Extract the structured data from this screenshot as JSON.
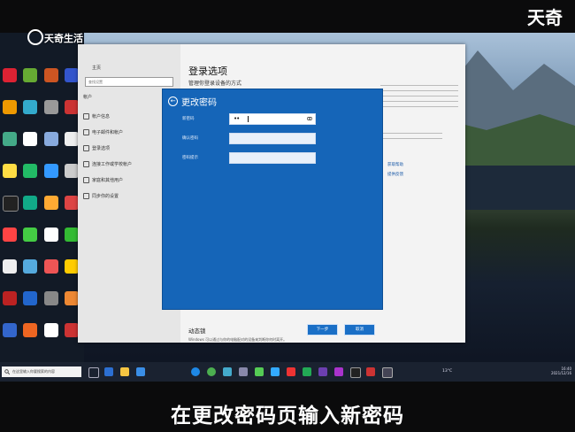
{
  "watermark": {
    "left_logo": "天奇生活",
    "right_logo": "天奇"
  },
  "caption": "在更改密码页输入新密码",
  "settings": {
    "home": "主页",
    "search_placeholder": "查找设置",
    "section": "帐户",
    "nav": [
      "帐户信息",
      "电子邮件和帐户",
      "登录选项",
      "连接工作或学校帐户",
      "家庭和其他用户",
      "同步你的设置"
    ],
    "page_title": "登录选项",
    "page_subtitle": "管理你登录设备的方式",
    "right_links": [
      "获取帮助",
      "提供反馈"
    ],
    "dynamic_lock_title": "动态锁",
    "dynamic_lock_desc": "Windows 可以通过与你的电脑配对的设备来判断你何时离开。"
  },
  "dialog": {
    "title": "更改密码",
    "new_password_label": "新密码",
    "confirm_password_label": "确认密码",
    "hint_label": "密码提示",
    "new_password_value": "••",
    "next_button": "下一步",
    "cancel_button": "取消"
  },
  "taskbar": {
    "search_placeholder": "在这里输入你要搜索的内容",
    "temperature": "13°C",
    "time": "16:40",
    "date": "2021/12/16"
  },
  "colors": {
    "dialog_bg": "#1565b8",
    "taskbar_bg": "#1a2230",
    "settings_bg": "#f3f3f3"
  }
}
